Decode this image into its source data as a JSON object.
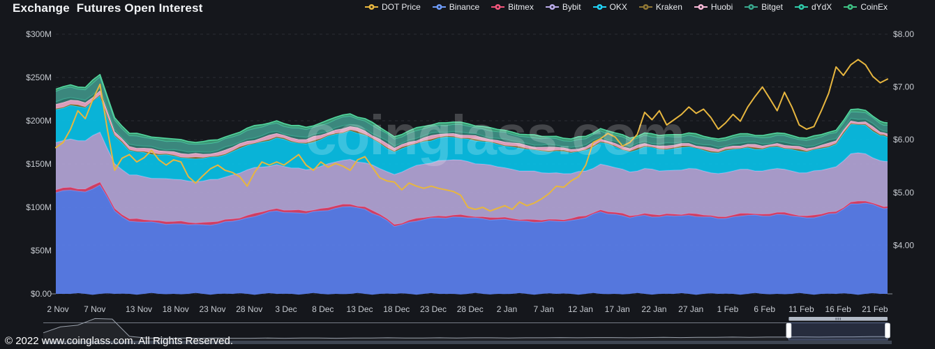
{
  "header": {
    "title": "Exchange  Futures Open Interest"
  },
  "watermark": "coinglass.com",
  "footer": {
    "copyright": "© 2022 www.coinglass.com. All Rights Reserved."
  },
  "colors": {
    "background": "#15171c",
    "grid": "rgba(255,255,255,0.10)",
    "axis_text": "#c7cbd1",
    "navigator_outline": "#878e9a",
    "navigator_bar": "#b2bac6",
    "navigator_handle": "#ffffff",
    "navigator_selection": "rgba(100,125,180,0.22)"
  },
  "legend": [
    {
      "label": "DOT Price",
      "color": "#e7b63f"
    },
    {
      "label": "Binance",
      "color": "#6e9bf8"
    },
    {
      "label": "Bitmex",
      "color": "#f2567c"
    },
    {
      "label": "Bybit",
      "color": "#b9aae8"
    },
    {
      "label": "OKX",
      "color": "#22d2f5"
    },
    {
      "label": "Kraken",
      "color": "#8f7634"
    },
    {
      "label": "Huobi",
      "color": "#f6b8d6"
    },
    {
      "label": "Bitget",
      "color": "#38a68c"
    },
    {
      "label": "dYdX",
      "color": "#2fc9a8"
    },
    {
      "label": "CoinEx",
      "color": "#3fc184"
    }
  ],
  "chart_data": {
    "type": "area",
    "stacking": "normal",
    "title": "Exchange  Futures Open Interest",
    "legend_position": "top-right",
    "grid": "horizontal-dashed",
    "left_axis": {
      "unit": "USD open interest",
      "tick_labels": [
        "$300M",
        "$250M",
        "$200M",
        "$150M",
        "$100M",
        "$50M",
        "$0.00"
      ],
      "values_M": [
        300,
        250,
        200,
        150,
        100,
        50,
        0
      ],
      "ylim_M": [
        0,
        300
      ]
    },
    "right_axis": {
      "unit": "DOT price USD",
      "tick_labels": [
        "$8.00",
        "$7.00",
        "$6.00",
        "$5.00",
        "$4.00"
      ],
      "values": [
        8,
        7,
        6,
        5,
        4
      ],
      "ylim": [
        3.08,
        8
      ]
    },
    "x_tick_labels": [
      "2 Nov",
      "7 Nov",
      "13 Nov",
      "18 Nov",
      "23 Nov",
      "28 Nov",
      "3 Dec",
      "8 Dec",
      "13 Dec",
      "18 Dec",
      "23 Dec",
      "28 Dec",
      "2 Jan",
      "7 Jan",
      "12 Jan",
      "17 Jan",
      "22 Jan",
      "27 Jan",
      "1 Feb",
      "6 Feb",
      "11 Feb",
      "16 Feb",
      "21 Feb"
    ],
    "x_tick_days": [
      0,
      5,
      11,
      16,
      21,
      26,
      31,
      36,
      41,
      46,
      51,
      56,
      61,
      66,
      71,
      76,
      81,
      86,
      91,
      96,
      101,
      106,
      111
    ],
    "x_total_days": 113,
    "dates": [
      "2 Nov",
      "4 Nov",
      "6 Nov",
      "8 Nov",
      "10 Nov",
      "12 Nov",
      "14 Nov",
      "16 Nov",
      "18 Nov",
      "20 Nov",
      "22 Nov",
      "24 Nov",
      "26 Nov",
      "28 Nov",
      "30 Nov",
      "2 Dec",
      "4 Dec",
      "6 Dec",
      "8 Dec",
      "10 Dec",
      "12 Dec",
      "14 Dec",
      "16 Dec",
      "18 Dec",
      "20 Dec",
      "22 Dec",
      "24 Dec",
      "26 Dec",
      "28 Dec",
      "30 Dec",
      "1 Jan",
      "3 Jan",
      "5 Jan",
      "7 Jan",
      "9 Jan",
      "11 Jan",
      "13 Jan",
      "15 Jan",
      "17 Jan",
      "19 Jan",
      "21 Jan",
      "23 Jan",
      "25 Jan",
      "27 Jan",
      "29 Jan",
      "31 Jan",
      "2 Feb",
      "4 Feb",
      "6 Feb",
      "8 Feb",
      "10 Feb",
      "12 Feb",
      "14 Feb",
      "16 Feb",
      "18 Feb",
      "20 Feb",
      "22 Feb",
      "23 Feb"
    ],
    "series_unit": "$M",
    "series": [
      {
        "name": "Binance",
        "fill": "#5b80ee",
        "stroke": "#6a92f5",
        "values": [
          117,
          120,
          118,
          126,
          96,
          84,
          83,
          82,
          81,
          80,
          80,
          81,
          84,
          88,
          92,
          96,
          94,
          93,
          96,
          99,
          101,
          98,
          90,
          78,
          83,
          86,
          88,
          89,
          88,
          87,
          86,
          85,
          84,
          83,
          84,
          85,
          88,
          95,
          92,
          88,
          91,
          89,
          90,
          91,
          89,
          87,
          89,
          91,
          90,
          92,
          90,
          88,
          90,
          93,
          104,
          105,
          100,
          99
        ]
      },
      {
        "name": "Bitmex",
        "fill": "#d94468",
        "stroke": "#e8395f",
        "values": [
          3,
          3,
          3,
          3,
          2.5,
          2.5,
          2.5,
          2.5,
          2.5,
          2.5,
          2.5,
          2.5,
          2.5,
          2.5,
          2.5,
          2.5,
          2.5,
          2.5,
          2.5,
          2.5,
          2.5,
          2.5,
          2,
          2,
          2,
          2,
          2,
          2,
          2,
          2,
          2,
          2,
          2,
          2,
          2,
          2,
          2,
          2,
          2,
          2,
          2,
          2,
          2,
          2,
          2,
          2,
          2,
          2,
          2,
          2,
          2,
          2,
          2,
          2,
          2,
          2,
          2,
          2
        ]
      },
      {
        "name": "Bybit",
        "fill": "#b3a5d6",
        "stroke": "#beafe0",
        "values": [
          55,
          56,
          56,
          58,
          52,
          51,
          50,
          49,
          49,
          48,
          48,
          49,
          51,
          53,
          52,
          51,
          49,
          48,
          49,
          51,
          52,
          51,
          53,
          58,
          60,
          62,
          64,
          64,
          63,
          61,
          59,
          57,
          56,
          55,
          54,
          52,
          52,
          53,
          52,
          51,
          52,
          51,
          51,
          52,
          51,
          50,
          51,
          51,
          50,
          51,
          50,
          50,
          51,
          52,
          56,
          55,
          52,
          52
        ]
      },
      {
        "name": "OKX",
        "fill": "#09c1e7",
        "stroke": "#27d1f3",
        "values": [
          38,
          39,
          38,
          42,
          32,
          28,
          28,
          27,
          27,
          26,
          26,
          26,
          27,
          28,
          29,
          31,
          30,
          30,
          31,
          32,
          33,
          32,
          29,
          26,
          26,
          26,
          26,
          26,
          26,
          26,
          26,
          26,
          25,
          25,
          25,
          24,
          24,
          25,
          24,
          23,
          25,
          25,
          25,
          25,
          24,
          24,
          25,
          25,
          25,
          25,
          25,
          24,
          25,
          26,
          34,
          33,
          29,
          28
        ]
      },
      {
        "name": "Kraken",
        "fill": "#7c6a33",
        "stroke": "#8f7634",
        "values": [
          1,
          1,
          1,
          1,
          1,
          1,
          1,
          1,
          1,
          1,
          1,
          1,
          1,
          1,
          1,
          1,
          1,
          1,
          1,
          1,
          1,
          1,
          1,
          1,
          1,
          1,
          1,
          1,
          1,
          1,
          1,
          1,
          1,
          1,
          1,
          1,
          1,
          1,
          1,
          1,
          1,
          1,
          1,
          1,
          1,
          1,
          1,
          1,
          1,
          1,
          1,
          1,
          1,
          1,
          1,
          1,
          1,
          1
        ]
      },
      {
        "name": "Huobi",
        "fill": "#eda9c9",
        "stroke": "#f7bcd8",
        "values": [
          5,
          5,
          5,
          5,
          4,
          4,
          4,
          4,
          4,
          4,
          4,
          4,
          4,
          4,
          4,
          4,
          4,
          4,
          4,
          4,
          4,
          4,
          4,
          3.5,
          3.5,
          3.5,
          3.5,
          3.5,
          3.5,
          3.5,
          3.5,
          3.5,
          3.5,
          3.5,
          3.5,
          3,
          3,
          3,
          3,
          3,
          3,
          3,
          3,
          3,
          3,
          3,
          3,
          3,
          3,
          3,
          3,
          3,
          3,
          3,
          3,
          3,
          3,
          3
        ]
      },
      {
        "name": "Bitget",
        "fill": "#31756c",
        "stroke": "#3aa88f",
        "values": [
          3,
          3,
          3,
          3,
          2.5,
          2.5,
          2.5,
          2.5,
          2.5,
          2.5,
          2.5,
          2.5,
          2.5,
          2.5,
          2.5,
          2.5,
          2.5,
          2.5,
          2.5,
          2.5,
          2.5,
          2.5,
          2.5,
          2.5,
          2.5,
          2.5,
          2.5,
          2.5,
          2.5,
          2.5,
          2.5,
          2.5,
          2.5,
          2.5,
          2.5,
          2.5,
          2.5,
          2.5,
          2.5,
          2.5,
          2.5,
          2.5,
          2.5,
          2.5,
          2.5,
          2.5,
          2.5,
          2.5,
          2.5,
          2.5,
          2.5,
          2.5,
          2.5,
          2.5,
          3,
          3,
          3,
          3
        ]
      },
      {
        "name": "dYdX",
        "fill": "#3f9185",
        "stroke": "#49bfa0",
        "values": [
          12,
          12,
          12,
          13,
          11,
          10,
          10,
          10,
          9.5,
          9.5,
          9.5,
          9.5,
          9.5,
          10,
          10,
          9.5,
          9,
          9,
          9,
          9.5,
          9.5,
          9,
          8.5,
          8,
          8,
          8,
          8,
          8,
          8,
          8,
          7.5,
          7.5,
          7.5,
          7.5,
          7.5,
          7,
          7,
          7,
          7,
          7,
          7,
          7,
          7,
          7,
          7,
          7,
          7,
          7,
          7,
          7,
          7,
          7,
          7,
          7,
          7.5,
          7.5,
          7,
          7
        ]
      },
      {
        "name": "CoinEx",
        "fill": "#3f9e7a",
        "stroke": "#52d89f",
        "values": [
          2.5,
          2.5,
          2.5,
          2.5,
          2.5,
          2.5,
          2.5,
          2.5,
          2.5,
          2.5,
          2.5,
          2.5,
          2.5,
          2.5,
          2.5,
          2.5,
          2.5,
          2.5,
          2.5,
          2.5,
          2.5,
          2.5,
          2.5,
          2.5,
          2.5,
          2.5,
          2.5,
          2.5,
          2.5,
          2.5,
          2.5,
          2.5,
          2.5,
          2.5,
          2.5,
          2.5,
          2.5,
          2.5,
          2.5,
          2.5,
          2.5,
          2.5,
          2.5,
          2.5,
          2.5,
          2.5,
          2.5,
          2.5,
          2.5,
          2.5,
          2.5,
          2.5,
          2.5,
          2.5,
          2.5,
          2.5,
          2.5,
          2.5
        ]
      }
    ],
    "price_series": {
      "name": "DOT Price",
      "color": "#e7b63f",
      "unit": "USD",
      "cadence": "daily from 2 Nov to 23 Feb",
      "values": [
        5.85,
        5.95,
        6.2,
        6.55,
        6.4,
        6.75,
        7.05,
        6.2,
        5.42,
        5.65,
        5.72,
        5.58,
        5.66,
        5.8,
        5.62,
        5.52,
        5.62,
        5.58,
        5.3,
        5.18,
        5.32,
        5.45,
        5.52,
        5.42,
        5.38,
        5.3,
        5.12,
        5.38,
        5.58,
        5.52,
        5.58,
        5.52,
        5.62,
        5.72,
        5.52,
        5.42,
        5.58,
        5.48,
        5.55,
        5.5,
        5.42,
        5.62,
        5.68,
        5.48,
        5.28,
        5.22,
        5.2,
        5.05,
        5.18,
        5.12,
        5.08,
        5.12,
        5.08,
        5.05,
        5.02,
        4.95,
        4.72,
        4.68,
        4.72,
        4.65,
        4.7,
        4.75,
        4.68,
        4.82,
        4.75,
        4.8,
        4.88,
        4.98,
        5.12,
        5.1,
        5.22,
        5.3,
        5.52,
        5.95,
        6.02,
        6.12,
        6.05,
        5.88,
        5.95,
        6.1,
        6.52,
        6.38,
        6.55,
        6.28,
        6.38,
        6.48,
        6.62,
        6.5,
        6.58,
        6.42,
        6.2,
        6.32,
        6.48,
        6.35,
        6.62,
        6.82,
        7.0,
        6.78,
        6.55,
        6.9,
        6.62,
        6.28,
        6.2,
        6.25,
        6.55,
        6.88,
        7.38,
        7.22,
        7.42,
        7.52,
        7.42,
        7.2,
        7.08,
        7.15
      ]
    },
    "navigator": {
      "selection_start_frac": 0.883,
      "selection_end_frac": 1.0,
      "values": [
        0.3,
        0.55,
        0.62,
        0.9,
        0.88,
        0.15,
        0.08,
        0.07,
        0.08,
        0.07,
        0.08,
        0.07,
        0.07,
        0.08,
        0.07,
        0.08,
        0.08,
        0.07,
        0.08,
        0.08,
        0.09,
        0.08,
        0.08,
        0.09,
        0.08,
        0.09,
        0.09,
        0.08,
        0.09,
        0.09,
        0.1,
        0.09,
        0.1,
        0.1,
        0.09,
        0.1,
        0.11,
        0.1,
        0.11,
        0.11,
        0.12,
        0.11,
        0.12,
        0.12,
        0.13,
        0.12,
        0.13,
        0.13,
        0.14,
        0.14
      ]
    }
  }
}
